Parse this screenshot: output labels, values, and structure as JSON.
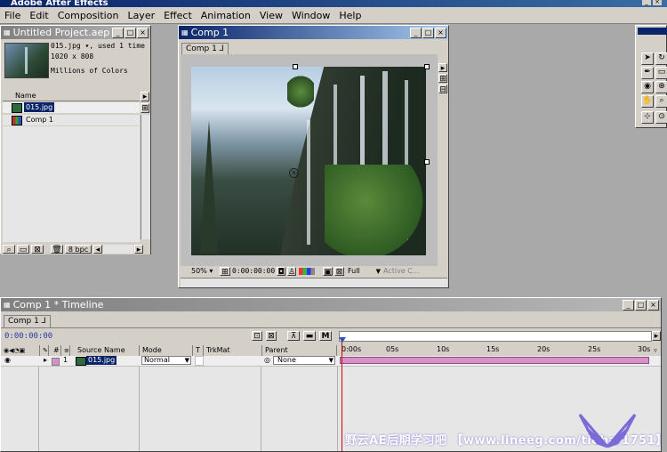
{
  "app": {
    "title": "Adobe After Effects"
  },
  "menu": [
    "File",
    "Edit",
    "Composition",
    "Layer",
    "Effect",
    "Animation",
    "View",
    "Window",
    "Help"
  ],
  "project": {
    "title": "Untitled Project.aep",
    "info_name": "015.jpg ▾, used 1 time",
    "info_size": "1020 x 808",
    "info_colors": "Millions of Colors",
    "column_name": "Name",
    "items": [
      {
        "name": "015.jpg",
        "type": "footage"
      },
      {
        "name": "Comp 1",
        "type": "comp"
      }
    ],
    "bpc": "8 bpc"
  },
  "comp": {
    "title": "Comp 1",
    "tab": "Comp 1 ⅃",
    "zoom": "50% ▾",
    "timecode": "0:00:00:00",
    "resolution": "Full",
    "camera": "Active C..."
  },
  "timeline": {
    "title": "Comp 1 * Timeline",
    "tab": "Comp 1 ⅃",
    "timecode": "0:00:00:00",
    "cols": {
      "num": "#",
      "source": "Source Name",
      "mode": "Mode",
      "t": "T",
      "trkmat": "TrkMat",
      "parent": "Parent"
    },
    "ruler": [
      "0:00s",
      "05s",
      "10s",
      "15s",
      "20s",
      "25s",
      "30s"
    ],
    "layer": {
      "num": "1",
      "name": "015.jpg",
      "mode": "Normal",
      "parent": "None"
    }
  },
  "watermark": "野云AE后期学习吧 【www.lineeg.com/tieba/1751】",
  "colors": {
    "accent": "#0a246a",
    "layer_bar": "#d98fc8",
    "cti": "#d00000"
  }
}
